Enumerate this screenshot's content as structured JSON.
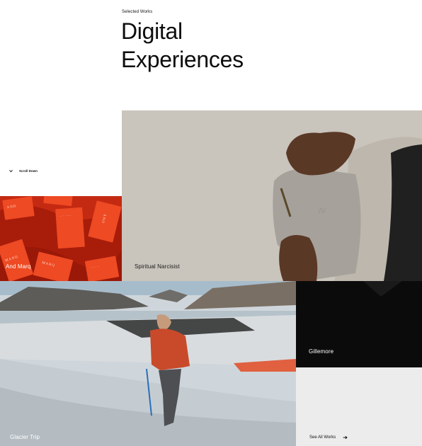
{
  "header": {
    "eyebrow": "Selected Works",
    "title_line1": "Digital",
    "title_line2": "Experiences"
  },
  "scroll": {
    "label": "Scroll Down",
    "icon": "chevron-down-icon"
  },
  "works": [
    {
      "title": "And Marq"
    },
    {
      "title": "Spiritual Narcisist"
    },
    {
      "title": "Glacier Trip"
    },
    {
      "title": "Gillemore"
    }
  ],
  "see_all": {
    "label": "See All Works",
    "icon": "arrow-right-icon"
  },
  "colors": {
    "and_marq": "#b8200c",
    "spiritual_bg": "#c9c4bc",
    "gillemore_bg": "#0b0b0b",
    "see_all_bg": "#ececec"
  }
}
